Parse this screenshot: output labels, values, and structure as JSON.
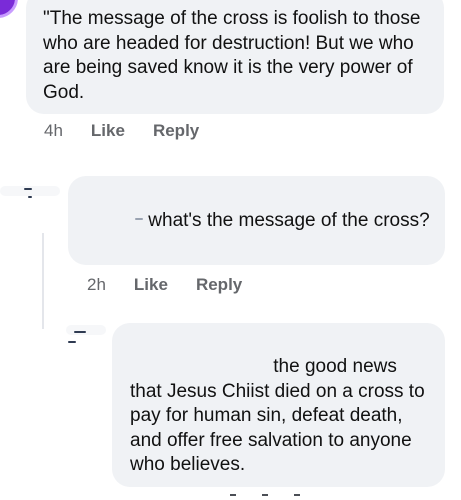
{
  "comments": [
    {
      "text": "\"The message of the cross is foolish to those who are headed for destruction! But we who are being saved know it is the very power of God.",
      "time": "4h",
      "like_label": "Like",
      "reply_label": "Reply"
    },
    {
      "text": "what's the message of the cross?",
      "time": "2h",
      "like_label": "Like",
      "reply_label": "Reply"
    },
    {
      "text": "the good news that Jesus Chiist died on a cross to pay for human sin, defeat death, and offer free salvation to anyone who believes."
    }
  ]
}
